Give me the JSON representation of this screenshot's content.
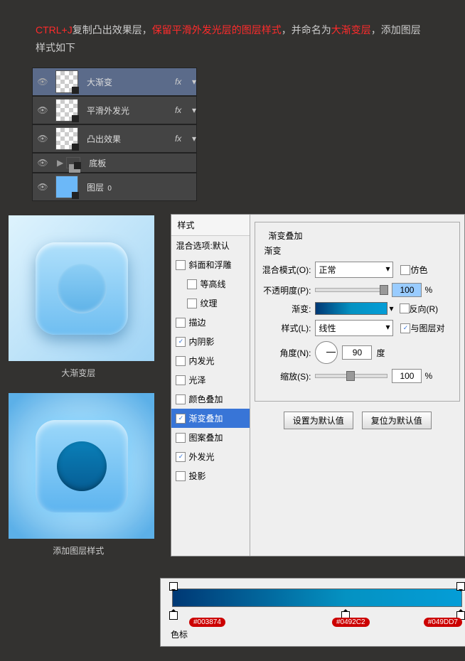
{
  "hdr": {
    "p1": "CTRL+J",
    "p2": "复制凸出效果层，",
    "p3": "保留平滑外发光层的图层样式",
    "p4": "，并命名为",
    "p5": "大渐变层",
    "p6": "，添加图层样式如下"
  },
  "layers": {
    "l1": "大渐变",
    "l2": "平滑外发光",
    "l3": "凸出效果",
    "l4": "底板",
    "l5": "图层",
    "zero": "0",
    "fx": "fx"
  },
  "pcap1": "大渐变层",
  "pcap2": "添加图层样式",
  "styles": {
    "hdr": "样式",
    "blend": "混合选项:默认",
    "bevel": "斜面和浮雕",
    "contour": "等高线",
    "texture": "纹理",
    "stroke": "描边",
    "innerShadow": "内阴影",
    "innerGlow": "内发光",
    "satin": "光泽",
    "colorOverlay": "颜色叠加",
    "gradOverlay": "渐变叠加",
    "patternOverlay": "图案叠加",
    "outerGlow": "外发光",
    "dropShadow": "投影"
  },
  "grad": {
    "group": "渐变叠加",
    "inner": "渐变",
    "blendMode": "混合模式(O):",
    "normal": "正常",
    "dither": "仿色",
    "opacity": "不透明度(P):",
    "opval": "100",
    "pct": "%",
    "gradient": "渐变:",
    "reverse": "反向(R)",
    "style": "样式(L):",
    "linear": "线性",
    "align": "与图层对",
    "angle": "角度(N):",
    "angval": "90",
    "deg": "度",
    "scale": "缩放(S):",
    "scaleval": "100"
  },
  "btns": {
    "def": "设置为默认值",
    "reset": "复位为默认值"
  },
  "colors": {
    "c1": "#003874",
    "c2": "#0492C2",
    "c3": "#049DD7"
  },
  "gfoot": "色标"
}
